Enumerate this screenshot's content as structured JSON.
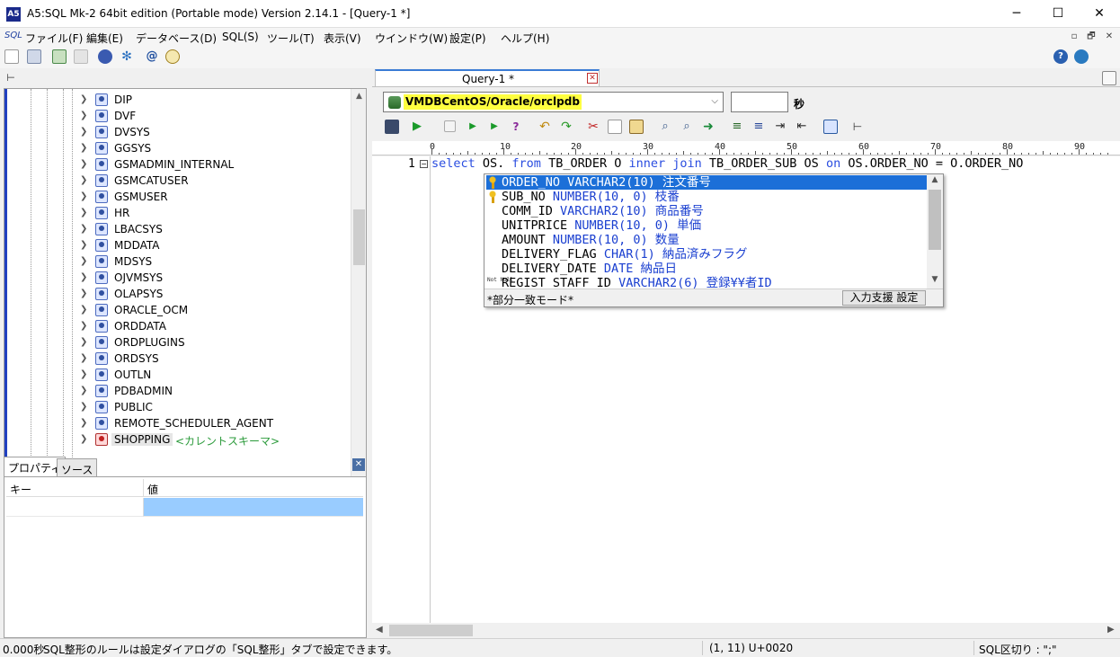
{
  "window": {
    "title": "A5:SQL Mk-2 64bit edition (Portable mode) Version 2.14.1 - [Query-1 *]",
    "app_icon_text": "A5",
    "controls": {
      "minimize": "─",
      "maximize": "☐",
      "close": "✕"
    }
  },
  "menubar": {
    "sql_glyph": "SQL",
    "items": [
      "ファイル(F)",
      "編集(E)",
      "データベース(D)",
      "SQL(S)",
      "ツール(T)",
      "表示(V)",
      "ウインドウ(W)",
      "設定(P)",
      "ヘルプ(H)"
    ],
    "mdi": [
      "▫",
      "🗗",
      "✕"
    ]
  },
  "tree": {
    "nodes": [
      "DIP",
      "DVF",
      "DVSYS",
      "GGSYS",
      "GSMADMIN_INTERNAL",
      "GSMCATUSER",
      "GSMUSER",
      "HR",
      "LBACSYS",
      "MDDATA",
      "MDSYS",
      "OJVMSYS",
      "OLAPSYS",
      "ORACLE_OCM",
      "ORDDATA",
      "ORDPLUGINS",
      "ORDSYS",
      "OUTLN",
      "PDBADMIN",
      "PUBLIC",
      "REMOTE_SCHEDULER_AGENT",
      "SHOPPING"
    ],
    "current_tag": "<カレントスキーマ>"
  },
  "properties": {
    "tabs": [
      "プロパティ",
      "ソース"
    ],
    "headers": {
      "key": "キー",
      "value": "値"
    }
  },
  "query": {
    "tab_label": "Query-1 *",
    "connection": "VMDBCentOS/Oracle/orclpdb",
    "seconds_label": "秒",
    "ruler": [
      "0",
      "10",
      "20",
      "30",
      "40",
      "50",
      "60",
      "70",
      "80",
      "90"
    ],
    "line_number": "1",
    "code": {
      "t1": "select",
      "t2": " OS. ",
      "t3": "from",
      "t4": " TB_ORDER O ",
      "t5": "inner join",
      "t6": " TB_ORDER_SUB OS ",
      "t7": "on",
      "t8": " OS.ORDER_NO = O.ORDER_NO"
    }
  },
  "completion": {
    "items": [
      {
        "name": "ORDER_NO",
        "type": "VARCHAR2(10)",
        "comment": "注文番号",
        "icon": "key"
      },
      {
        "name": "SUB_NO",
        "type": "NUMBER(10, 0)",
        "comment": "枝番",
        "icon": "key"
      },
      {
        "name": "COMM_ID",
        "type": "VARCHAR2(10)",
        "comment": "商品番号",
        "icon": ""
      },
      {
        "name": "UNITPRICE",
        "type": "NUMBER(10, 0)",
        "comment": "単価",
        "icon": ""
      },
      {
        "name": "AMOUNT",
        "type": "NUMBER(10, 0)",
        "comment": "数量",
        "icon": ""
      },
      {
        "name": "DELIVERY_FLAG",
        "type": "CHAR(1)",
        "comment": "納品済みフラグ",
        "icon": ""
      },
      {
        "name": "DELIVERY_DATE",
        "type": "DATE",
        "comment": "納品日",
        "icon": ""
      },
      {
        "name": "REGIST_STAFF_ID",
        "type": "VARCHAR2(6)",
        "comment": "登録¥¥者ID",
        "icon": "null"
      }
    ],
    "null_icon": "Not Null",
    "mode": "*部分一致モード*",
    "settings_button": "入力支援 設定"
  },
  "status": {
    "time": "0.000秒",
    "message": "SQL整形のルールは設定ダイアログの「SQL整形」タブで設定できます。",
    "position": "(1, 11) U+0020",
    "delimiter": "SQL区切り : \";\""
  },
  "colors": {
    "keyword": "#2a4de0",
    "selection": "#1c6fd8",
    "connection_highlight": "#ffff40",
    "current_schema_tag": "#2a9a3a",
    "tree_accent": "#2040c0"
  }
}
